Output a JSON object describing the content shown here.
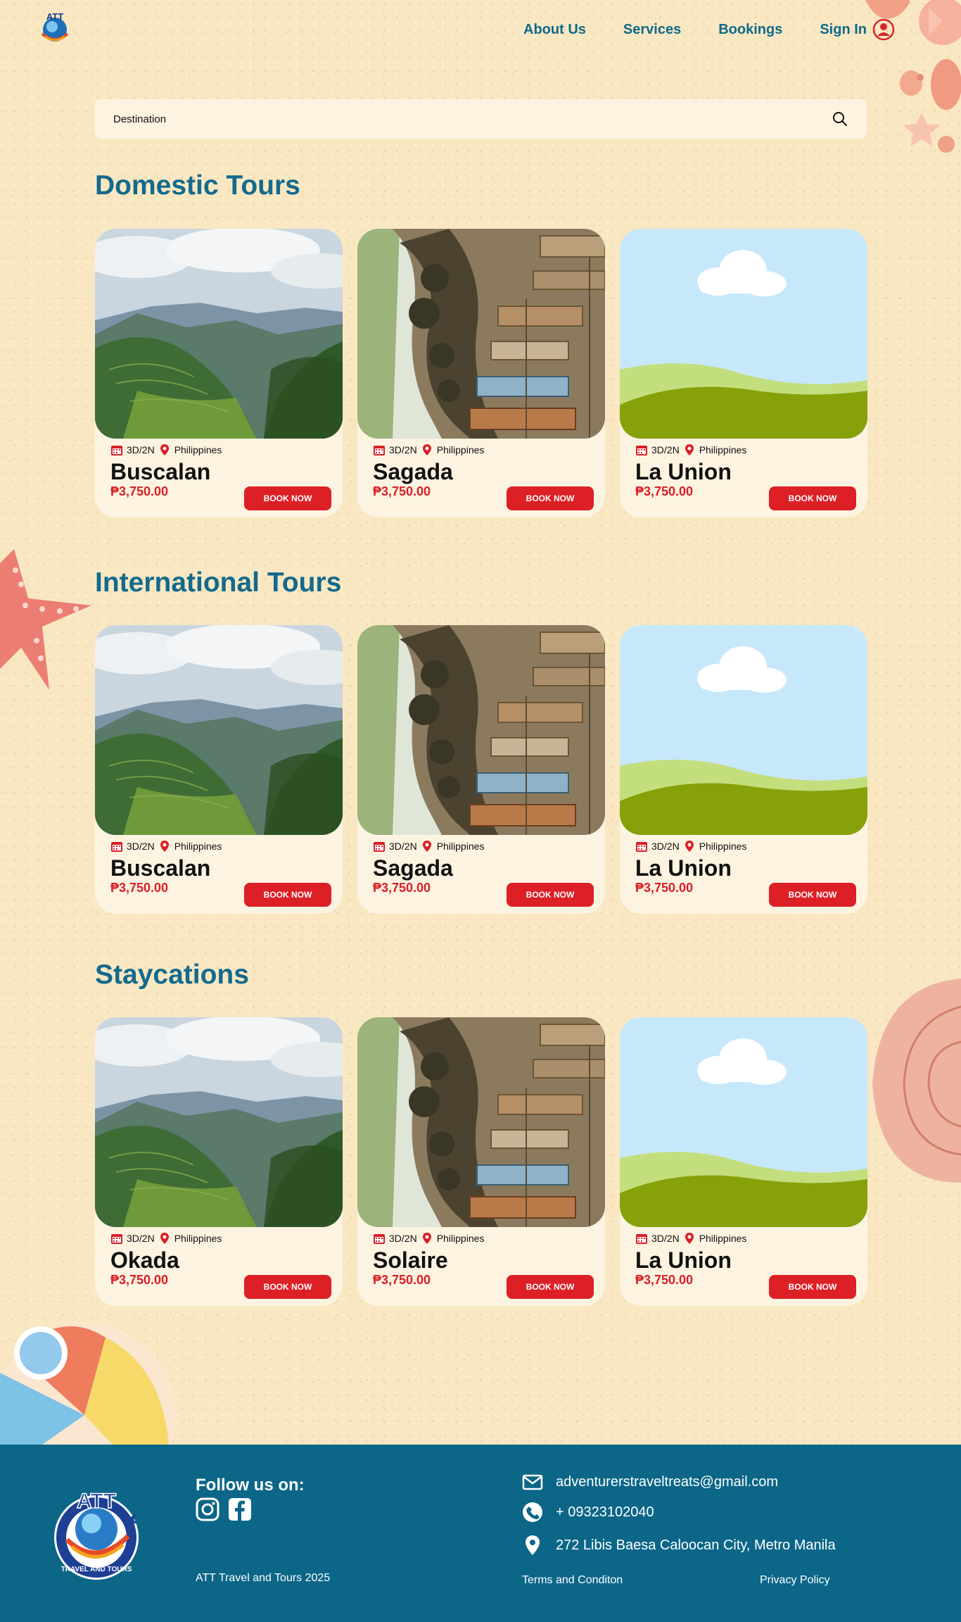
{
  "header": {
    "nav": [
      {
        "label": "About Us"
      },
      {
        "label": "Services"
      },
      {
        "label": "Bookings"
      }
    ],
    "signin_label": "Sign In",
    "logo_text": "ATT"
  },
  "search": {
    "placeholder": "Destination"
  },
  "sections": [
    {
      "title": "Domestic Tours",
      "cards": [
        {
          "image": "rice-terraces",
          "duration": "3D/2N",
          "location": "Philippines",
          "name": "Buscalan",
          "price": "₱3,750.00",
          "button": "BOOK NOW"
        },
        {
          "image": "hanging-coffins",
          "duration": "3D/2N",
          "location": "Philippines",
          "name": "Sagada",
          "price": "₱3,750.00",
          "button": "BOOK NOW"
        },
        {
          "image": "placeholder-landscape",
          "duration": "3D/2N",
          "location": "Philippines",
          "name": "La Union",
          "price": "₱3,750.00",
          "button": "BOOK NOW"
        }
      ]
    },
    {
      "title": "International Tours",
      "cards": [
        {
          "image": "rice-terraces",
          "duration": "3D/2N",
          "location": "Philippines",
          "name": "Buscalan",
          "price": "₱3,750.00",
          "button": "BOOK NOW"
        },
        {
          "image": "hanging-coffins",
          "duration": "3D/2N",
          "location": "Philippines",
          "name": "Sagada",
          "price": "₱3,750.00",
          "button": "BOOK NOW"
        },
        {
          "image": "placeholder-landscape",
          "duration": "3D/2N",
          "location": "Philippines",
          "name": "La Union",
          "price": "₱3,750.00",
          "button": "BOOK NOW"
        }
      ]
    },
    {
      "title": "Staycations",
      "cards": [
        {
          "image": "rice-terraces",
          "duration": "3D/2N",
          "location": "Philippines",
          "name": "Okada",
          "price": "₱3,750.00",
          "button": "BOOK NOW"
        },
        {
          "image": "hanging-coffins",
          "duration": "3D/2N",
          "location": "Philippines",
          "name": "Solaire",
          "price": "₱3,750.00",
          "button": "BOOK NOW"
        },
        {
          "image": "placeholder-landscape",
          "duration": "3D/2N",
          "location": "Philippines",
          "name": "La Union",
          "price": "₱3,750.00",
          "button": "BOOK NOW"
        }
      ]
    }
  ],
  "footer": {
    "follow_label": "Follow us on:",
    "social_icons": [
      "instagram-icon",
      "facebook-icon"
    ],
    "copyright": "ATT Travel and Tours 2025",
    "email": "adventurerstraveltreats@gmail.com",
    "phone": "+ 09323102040",
    "address": "272 Libis Baesa Caloocan City, Metro Manila",
    "terms_label": "Terms and Conditon",
    "privacy_label": "Privacy Policy",
    "logo_text": "ATT",
    "logo_ring_text": "TRAVEL AND TOURS"
  },
  "colors": {
    "background": "#f9e7c2",
    "brand_blue": "#0e6a8a",
    "footer_blue": "#0b6688",
    "accent_red": "#dd1f26",
    "card_bg": "#fdf3e1"
  }
}
